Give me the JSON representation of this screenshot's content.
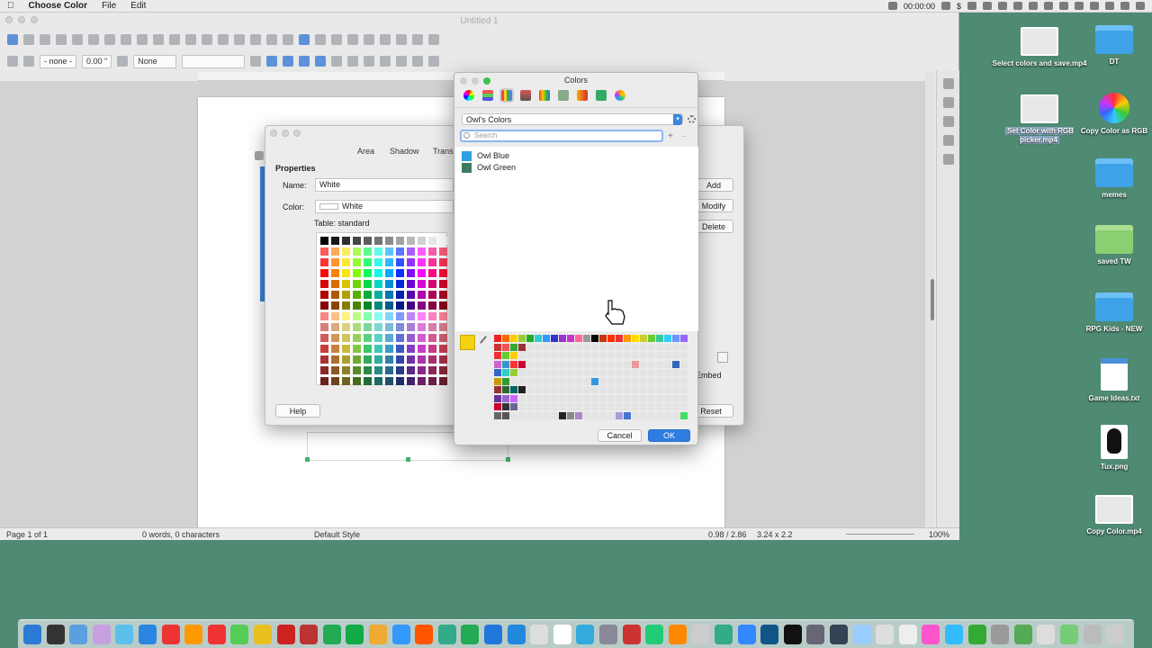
{
  "menubar": {
    "app_name": "Choose Color",
    "menus": [
      "File",
      "Edit"
    ],
    "clock": "00:00:00",
    "dollar": "$"
  },
  "window": {
    "title": "Untitled 1"
  },
  "toolbar2": {
    "line_style": "- none -",
    "line_width": "0.00 \"",
    "area_style": "None"
  },
  "statusbar": {
    "page": "Page 1 of 1",
    "words": "0 words, 0 characters",
    "style": "Default Style",
    "position": "0.98 / 2.86",
    "size": "3.24 x 2.2",
    "zoom": "100%"
  },
  "area_dialog": {
    "tabs": [
      "Area",
      "Shadow",
      "Transp"
    ],
    "section": "Properties",
    "name_label": "Name:",
    "name_value": "White",
    "color_label": "Color:",
    "color_value": "White",
    "table_label": "Table: standard",
    "buttons": {
      "add": "Add",
      "modify": "Modify",
      "delete": "Delete",
      "embed": "Embed",
      "help": "Help",
      "reset": "Reset"
    }
  },
  "colors_panel": {
    "title": "Colors",
    "list_name": "Owl's Colors",
    "search_placeholder": "Search",
    "items": [
      {
        "name": "Owl Blue",
        "color": "#2e9fe0"
      },
      {
        "name": "Owl Green",
        "color": "#3f7b62"
      }
    ],
    "current_color": "#f5d20f",
    "cancel": "Cancel",
    "ok": "OK"
  },
  "desktop": {
    "icons": [
      {
        "label": "Select colors and save.mp4",
        "type": "video"
      },
      {
        "label": "DT",
        "type": "folder"
      },
      {
        "label": "Set Color with RGB picker.mp4",
        "type": "video"
      },
      {
        "label": "Copy Color as RGB",
        "type": "app"
      },
      {
        "label": "memes",
        "type": "folder"
      },
      {
        "label": "saved TW",
        "type": "gfolder"
      },
      {
        "label": "RPG Kids - NEW",
        "type": "folder"
      },
      {
        "label": "Game Ideas.txt",
        "type": "text"
      },
      {
        "label": "Tux.png",
        "type": "image"
      },
      {
        "label": "Copy Color.mp4",
        "type": "video"
      }
    ]
  }
}
